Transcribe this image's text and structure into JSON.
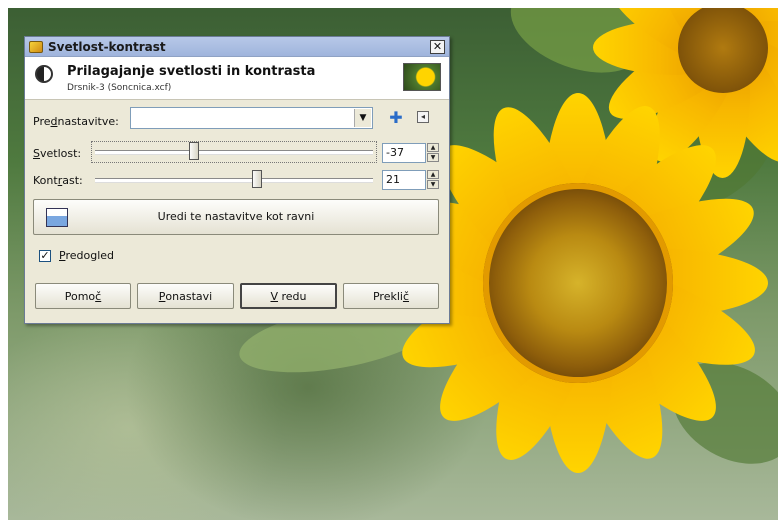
{
  "window": {
    "title": "Svetlost-kontrast",
    "close_glyph": "✕"
  },
  "header": {
    "title": "Prilagajanje svetlosti in kontrasta",
    "subtitle": "Drsnik-3 (Soncnica.xcf)",
    "icon": "brightness-contrast-icon"
  },
  "presets": {
    "label_pre": "Pre",
    "label_acc": "d",
    "label_post": "nastavitve:",
    "value": "",
    "arrow": "▼",
    "add_glyph": "✚",
    "menu_glyph": "◂"
  },
  "brightness": {
    "label_acc": "S",
    "label_post": "vetlost:",
    "value": "-37",
    "level": -37,
    "range": [
      -127,
      127
    ]
  },
  "contrast": {
    "label_pre": "Kont",
    "label_acc": "r",
    "label_post": "ast:",
    "value": "21",
    "level": 21,
    "range": [
      -127,
      127
    ]
  },
  "curves_button": {
    "label": "Uredi te nastavitve kot ravni"
  },
  "preview": {
    "checked": true,
    "check_glyph": "✓",
    "label_acc": "P",
    "label_post": "redogled"
  },
  "buttons": {
    "help_pre": "Pomo",
    "help_acc": "č",
    "reset_acc": "P",
    "reset_post": "onastavi",
    "ok_acc": "V",
    "ok_post": " redu",
    "cancel_pre": "Prekli",
    "cancel_acc": "č"
  },
  "spinner": {
    "up": "▲",
    "down": "▼"
  },
  "colors": {
    "dialog_bg": "#ece9d8",
    "title_bar": "#9fb4dc",
    "accent_blue": "#2a6cc8"
  }
}
